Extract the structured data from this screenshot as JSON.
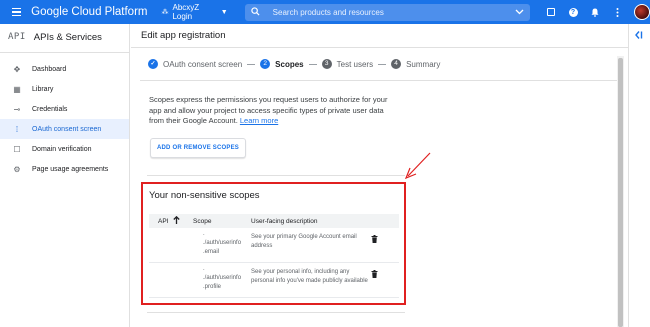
{
  "topbar": {
    "brand": "Google Cloud Platform",
    "project_name": "AbcxyZ Login",
    "search_placeholder": "Search products and resources"
  },
  "sidebar": {
    "api_logo": "API",
    "title": "APIs & Services",
    "items": [
      {
        "label": "Dashboard",
        "icon": "dashboard-icon"
      },
      {
        "label": "Library",
        "icon": "library-icon"
      },
      {
        "label": "Credentials",
        "icon": "key-icon"
      },
      {
        "label": "OAuth consent screen",
        "icon": "consent-icon",
        "active": true
      },
      {
        "label": "Domain verification",
        "icon": "verification-icon"
      },
      {
        "label": "Page usage agreements",
        "icon": "settings-icon"
      }
    ]
  },
  "main": {
    "page_title": "Edit app registration",
    "steps": [
      {
        "num": "✓",
        "label": "OAuth consent screen",
        "state": "done"
      },
      {
        "num": "2",
        "label": "Scopes",
        "state": "current"
      },
      {
        "num": "3",
        "label": "Test users",
        "state": "pending"
      },
      {
        "num": "4",
        "label": "Summary",
        "state": "pending"
      }
    ],
    "description": "Scopes express the permissions you request users to authorize for your app and allow your project to access specific types of private user data from their Google Account.",
    "learn_more": "Learn more",
    "add_scopes_button": "ADD OR REMOVE SCOPES",
    "scopes_title": "Your non-sensitive scopes",
    "table": {
      "headers": {
        "api": "API",
        "scope": "Scope",
        "description": "User-facing description"
      },
      "rows": [
        {
          "api": "",
          "scope_lines": [
            ".",
            "./auth/userinfo",
            ".email"
          ],
          "description": "See your primary Google Account email address"
        },
        {
          "api": "",
          "scope_lines": [
            ".",
            "./auth/userinfo",
            ".profile"
          ],
          "description": "See your personal info, including any personal info you've made publicly available"
        }
      ]
    }
  },
  "colors": {
    "accent": "#1a73e8",
    "highlight_box": "#e02020",
    "active_nav_bg": "#e8f0fe"
  }
}
